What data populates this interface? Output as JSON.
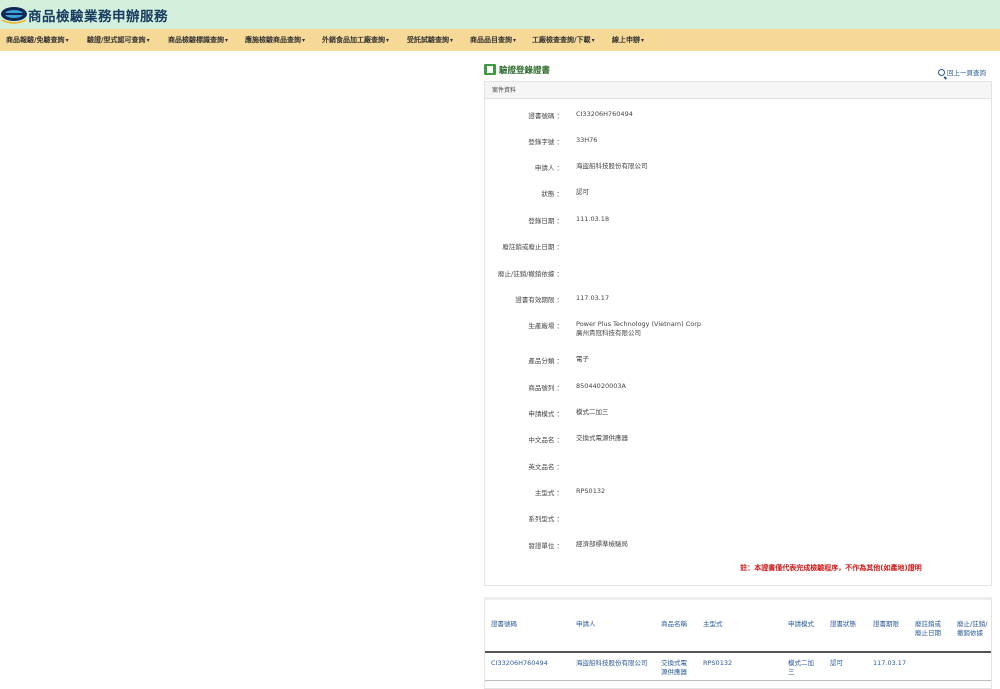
{
  "site": {
    "title": "商品檢驗業務申辦服務"
  },
  "nav": [
    {
      "label": "商品報驗/免驗查詢",
      "caret": "▾"
    },
    {
      "label": "驗證/型式認可查詢",
      "caret": "▾"
    },
    {
      "label": "商品檢驗標識查詢",
      "caret": "▾"
    },
    {
      "label": "應施檢驗商品查詢",
      "caret": "▾"
    },
    {
      "label": "外銷食品加工廠查詢",
      "caret": "▾"
    },
    {
      "label": "受託試驗查詢",
      "caret": "▾"
    },
    {
      "label": "商品品目查詢",
      "caret": "▾"
    },
    {
      "label": "工廠檢查查詢/下載",
      "caret": "▾"
    },
    {
      "label": "線上申辦",
      "caret": "▾"
    }
  ],
  "page": {
    "title": "驗證登錄證書",
    "back_label": "回上一頁查詢"
  },
  "case": {
    "header": "案件資料",
    "fields": [
      {
        "label": "證書號碼 ：",
        "value": "CI33206H760494"
      },
      {
        "label": "登錄字號 ：",
        "value": "33H76"
      },
      {
        "label": "申請人 ：",
        "value": "海盜船科技股份有限公司"
      },
      {
        "label": "狀態 ：",
        "value": "認可"
      },
      {
        "label": "登錄日期 ：",
        "value": "111.03.18"
      },
      {
        "label": "廢註銷或廢止日期 ：",
        "value": ""
      },
      {
        "label": "廢止/註銷/撤銷依據 ：",
        "value": ""
      },
      {
        "label": "證書有效期限 ：",
        "value": "117.03.17"
      },
      {
        "label": "生產廠場 ：",
        "value": "Power Plus Technology (Vietnam) Corp",
        "value2": "廣州貴冠科技有限公司"
      },
      {
        "label": "產品分類 ：",
        "value": "電子"
      },
      {
        "label": "商品號列 ：",
        "value": "85044020003A"
      },
      {
        "label": "申請模式 ：",
        "value": "模式二加三"
      },
      {
        "label": "中文品名 ：",
        "value": "交換式電源供應器"
      },
      {
        "label": "英文品名 ：",
        "value": ""
      },
      {
        "label": "主型式 ：",
        "value": "RPS0132"
      },
      {
        "label": "系列型式 ：",
        "value": ""
      },
      {
        "label": "發證單位 ：",
        "value": "經濟部標準檢驗局"
      }
    ],
    "notice": "註：本證書僅代表完成檢驗程序，不作為其他(如產地)證明"
  },
  "table": {
    "headers": [
      "證書號碼",
      "申請人",
      "商品名稱",
      "主型式",
      "申請模式",
      "證書狀態",
      "證書期限",
      "廢註銷或廢止日期",
      "廢止/註銷/撤銷依據"
    ],
    "row": [
      "CI33206H760494",
      "海盜船科技股份有限公司",
      "交換式電源供應器",
      "RPS0132",
      "模式二加三",
      "認可",
      "117.03.17",
      "",
      ""
    ]
  }
}
